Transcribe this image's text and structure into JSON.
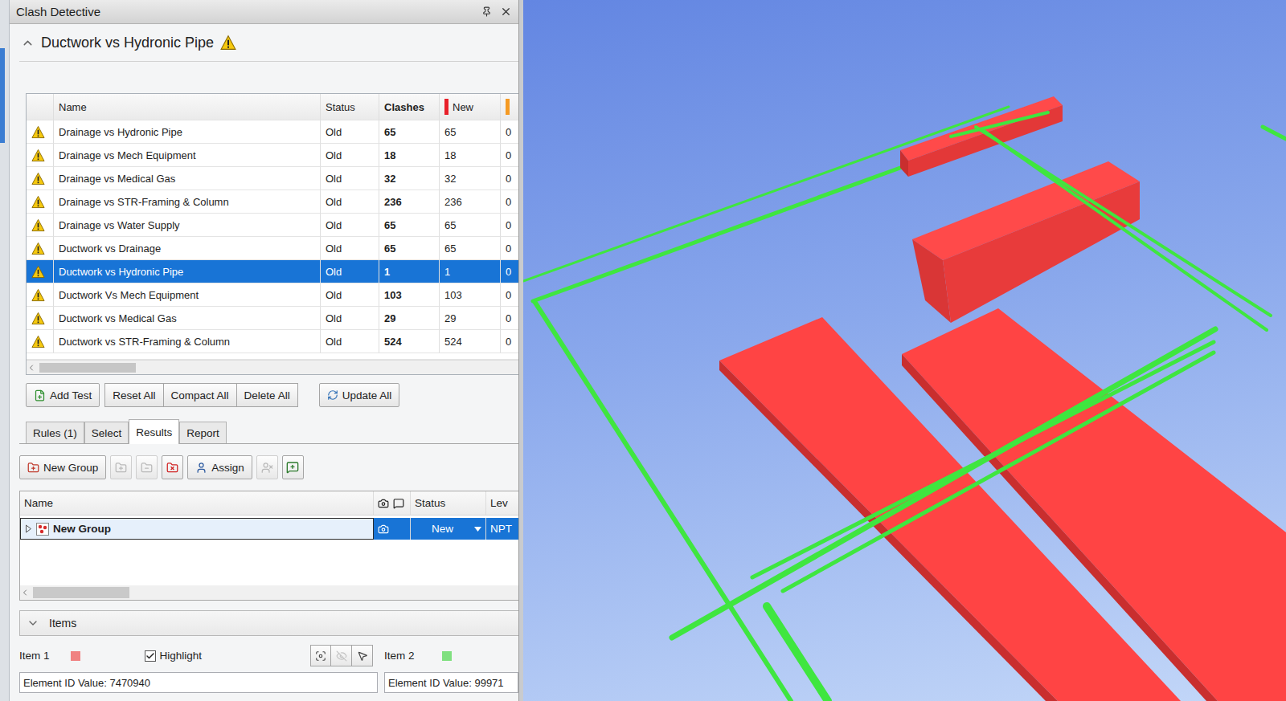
{
  "window": {
    "title": "Clash Detective"
  },
  "test_header": {
    "title": "Ductwork vs Hydronic Pipe",
    "expanded": true
  },
  "tests_table": {
    "columns": [
      {
        "label": "Name",
        "color": ""
      },
      {
        "label": "Status",
        "color": ""
      },
      {
        "label": "Clashes",
        "color": ""
      },
      {
        "label": "New",
        "color": "#e8202a"
      },
      {
        "label": "",
        "color": "#f59a23"
      }
    ],
    "rows": [
      {
        "name": "Drainage vs Hydronic Pipe",
        "status": "Old",
        "clashes": "65",
        "new": "65",
        "active": "0",
        "selected": false
      },
      {
        "name": "Drainage vs Mech Equipment",
        "status": "Old",
        "clashes": "18",
        "new": "18",
        "active": "0",
        "selected": false
      },
      {
        "name": "Drainage vs Medical Gas",
        "status": "Old",
        "clashes": "32",
        "new": "32",
        "active": "0",
        "selected": false
      },
      {
        "name": "Drainage vs STR-Framing & Column",
        "status": "Old",
        "clashes": "236",
        "new": "236",
        "active": "0",
        "selected": false
      },
      {
        "name": "Drainage vs Water Supply",
        "status": "Old",
        "clashes": "65",
        "new": "65",
        "active": "0",
        "selected": false
      },
      {
        "name": "Ductwork vs Drainage",
        "status": "Old",
        "clashes": "65",
        "new": "65",
        "active": "0",
        "selected": false
      },
      {
        "name": "Ductwork vs Hydronic Pipe",
        "status": "Old",
        "clashes": "1",
        "new": "1",
        "active": "0",
        "selected": true
      },
      {
        "name": "Ductwork Vs Mech Equipment",
        "status": "Old",
        "clashes": "103",
        "new": "103",
        "active": "0",
        "selected": false
      },
      {
        "name": "Ductwork vs Medical Gas",
        "status": "Old",
        "clashes": "29",
        "new": "29",
        "active": "0",
        "selected": false
      },
      {
        "name": "Ductwork vs STR-Framing & Column",
        "status": "Old",
        "clashes": "524",
        "new": "524",
        "active": "0",
        "selected": false
      }
    ]
  },
  "test_buttons": [
    "Add Test",
    "Reset All",
    "Compact All",
    "Delete All",
    "Update All"
  ],
  "tabs": [
    {
      "label": "Rules (1)",
      "selected": false
    },
    {
      "label": "Select",
      "selected": false
    },
    {
      "label": "Results",
      "selected": true
    },
    {
      "label": "Report",
      "selected": false
    }
  ],
  "results_toolbar": [
    {
      "kind": "button",
      "label": "New Group",
      "disabled": false
    },
    {
      "kind": "icon",
      "label": "",
      "disabled": true
    },
    {
      "kind": "icon",
      "label": "",
      "disabled": true
    },
    {
      "kind": "icon",
      "label": "",
      "disabled": false
    },
    {
      "kind": "button",
      "label": "Assign",
      "disabled": false
    },
    {
      "kind": "icon",
      "label": "",
      "disabled": true
    },
    {
      "kind": "icon",
      "label": "",
      "disabled": false
    }
  ],
  "results_table": {
    "columns": [
      "Name",
      "Status",
      "Lev"
    ],
    "rows": [
      {
        "name": "New Group",
        "status": "New",
        "level": "NPT",
        "expanded": false,
        "selected": true
      }
    ]
  },
  "items": {
    "label": "Items",
    "expanded": false,
    "highlight": {
      "label": "Highlight",
      "checked": true
    },
    "tools": [
      {
        "disabled": false
      },
      {
        "disabled": true
      },
      {
        "disabled": false
      }
    ],
    "entries": [
      {
        "label": "Item 1",
        "color": "#f08282",
        "value": "Element ID Value: 7470940"
      },
      {
        "label": "Item 2",
        "color": "#80e080",
        "value": "Element ID Value: 99971"
      }
    ]
  }
}
